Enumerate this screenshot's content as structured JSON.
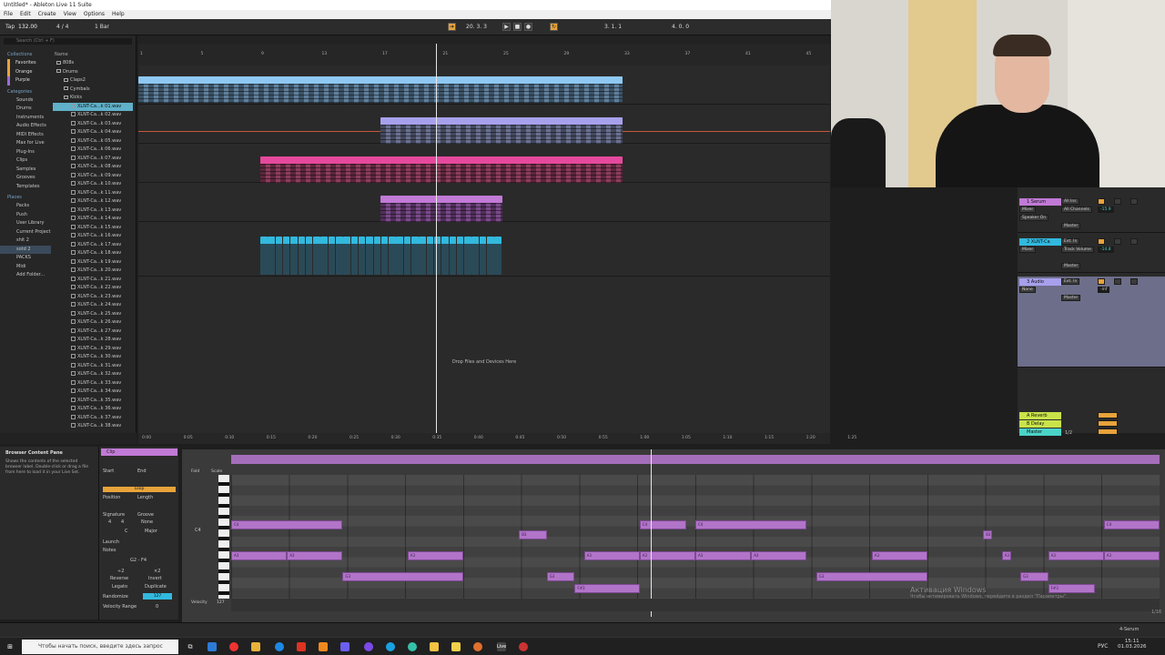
{
  "window": {
    "title": "Untitled* - Ableton Live 11 Suite",
    "menus": [
      "File",
      "Edit",
      "Create",
      "View",
      "Options",
      "Help"
    ]
  },
  "transport": {
    "tap": "Tap",
    "tempo": "132.00",
    "signature": "4 / 4",
    "quantize": "1 Bar",
    "position": "20. 3. 3",
    "loop_start": "3. 1. 1",
    "loop_length": "4. 0. 0",
    "accent": "#e8a33a"
  },
  "browser": {
    "search_placeholder": "Search (Ctrl + F)",
    "collections_header": "Collections",
    "name_header": "Name",
    "collections": [
      "Favorites",
      "Orange",
      "Purple"
    ],
    "categories_header": "Categories",
    "categories": [
      "Sounds",
      "Drums",
      "Instruments",
      "Audio Effects",
      "MIDI Effects",
      "Max for Live",
      "Plug-Ins",
      "Clips",
      "Samples",
      "Grooves",
      "Templates"
    ],
    "places_header": "Places",
    "places": [
      "Packs",
      "Push",
      "User Library",
      "Current Project",
      "shit 2",
      "sotd 2",
      "PACKS",
      "Midi",
      "Add Folder..."
    ],
    "folders": [
      "808s",
      "Drums",
      "Claps2",
      "Cymbals",
      "Kicks"
    ],
    "files": [
      "XLNT-Ca...k 01.wav",
      "XLNT-Ca...k 02.wav",
      "XLNT-Ca...k 03.wav",
      "XLNT-Ca...k 04.wav",
      "XLNT-Ca...k 05.wav",
      "XLNT-Ca...k 06.wav",
      "XLNT-Ca...k 07.wav",
      "XLNT-Ca...k 08.wav",
      "XLNT-Ca...k 09.wav",
      "XLNT-Ca...k 10.wav",
      "XLNT-Ca...k 11.wav",
      "XLNT-Ca...k 12.wav",
      "XLNT-Ca...k 13.wav",
      "XLNT-Ca...k 14.wav",
      "XLNT-Ca...k 15.wav",
      "XLNT-Ca...k 16.wav",
      "XLNT-Ca...k 17.wav",
      "XLNT-Ca...k 18.wav",
      "XLNT-Ca...k 19.wav",
      "XLNT-Ca...k 20.wav",
      "XLNT-Ca...k 21.wav",
      "XLNT-Ca...k 22.wav",
      "XLNT-Ca...k 23.wav",
      "XLNT-Ca...k 24.wav",
      "XLNT-Ca...k 25.wav",
      "XLNT-Ca...k 26.wav",
      "XLNT-Ca...k 27.wav",
      "XLNT-Ca...k 28.wav",
      "XLNT-Ca...k 29.wav",
      "XLNT-Ca...k 30.wav",
      "XLNT-Ca...k 31.wav",
      "XLNT-Ca...k 32.wav",
      "XLNT-Ca...k 33.wav",
      "XLNT-Ca...k 34.wav",
      "XLNT-Ca...k 35.wav",
      "XLNT-Ca...k 36.wav",
      "XLNT-Ca...k 37.wav",
      "XLNT-Ca...k 38.wav"
    ]
  },
  "ruler": {
    "bars": [
      "1",
      "5",
      "9",
      "13",
      "17",
      "21",
      "25",
      "29",
      "33",
      "37",
      "41",
      "45"
    ],
    "times": [
      "0:00",
      "0:05",
      "0:10",
      "0:15",
      "0:20",
      "0:25",
      "0:30",
      "0:35",
      "0:40",
      "0:45",
      "0:50",
      "0:55",
      "1:00",
      "1:05",
      "1:10",
      "1:15",
      "1:20",
      "1:25"
    ]
  },
  "arrangement": {
    "drop_text": "Drop Files and Devices Here"
  },
  "colors": {
    "blue_clip": "#8ec8f2",
    "lavender_clip": "#a7a0ec",
    "pink_clip": "#e5499d",
    "violet_clip": "#c17ad6",
    "cyan_clip": "#32b9de",
    "note": "#b174c9"
  },
  "mixer": {
    "tracks": [
      {
        "name": "1 Serum",
        "input": "All Ins",
        "route": "Mixer",
        "ch": "All Channels",
        "out": "Master",
        "dev": "Speaker On",
        "vol": "-15.9",
        "color": "#c17ad6"
      },
      {
        "name": "2 XLNT-Ca",
        "input": "Ext. In",
        "route": "Mixer",
        "ch": "Track Volume",
        "out": "Master",
        "vol": "-14.8",
        "color": "#32b9de"
      },
      {
        "name": "3 Audio",
        "input": "Ext. In",
        "route": "None",
        "out": "Master",
        "vol": "-inf",
        "color": "#a7a0ec"
      }
    ],
    "returns": [
      {
        "name": "A Reverb",
        "color": "#c9e34a"
      },
      {
        "name": "B Delay",
        "color": "#c9e34a"
      },
      {
        "name": "Master",
        "color": "#4ad3c8"
      }
    ],
    "master_ratio": "1/2"
  },
  "info_view": {
    "title": "Browser Content Pane",
    "text": "Shows the contents of the selected browser label. Double-click or drag a file from here to load it in your Live Set."
  },
  "clip_view": {
    "header": "Clip",
    "start": "Start",
    "end": "End",
    "loop": "Loop",
    "position": "Position",
    "length": "Length",
    "signature": "Signature",
    "groove": "Groove",
    "sig_n": "4",
    "sig_d": "4",
    "groove_val": "None",
    "scale_root": "C",
    "scale_mode": "Major",
    "launch": "Launch",
    "notes": "Notes",
    "range": "G2 - F4",
    "x2": "÷2",
    "times2": "×2",
    "reverse": "Reverse",
    "invert": "Invert",
    "legato": "Legato",
    "duplicate": "Duplicate",
    "randomize": "Randomize",
    "rand_val": "127",
    "vel_range": "Velocity Range",
    "vel_val": "0"
  },
  "piano_roll": {
    "fold": "Fold",
    "scale": "Scale",
    "c4": "C4",
    "velocity": "Velocity",
    "vel_max": "127",
    "ratio": "1/16",
    "notes": [
      {
        "lbl": "C4",
        "row": 0,
        "s": 0.0,
        "e": 0.12
      },
      {
        "lbl": "C4",
        "row": 0,
        "s": 0.44,
        "e": 0.49
      },
      {
        "lbl": "C4",
        "row": 0,
        "s": 0.5,
        "e": 0.62
      },
      {
        "lbl": "C4",
        "row": 0,
        "s": 0.94,
        "e": 1.0
      },
      {
        "lbl": "B3",
        "row": 1,
        "s": 0.31,
        "e": 0.34
      },
      {
        "lbl": "B3",
        "row": 1,
        "s": 0.81,
        "e": 0.82
      },
      {
        "lbl": "A3",
        "row": 3,
        "s": 0.0,
        "e": 0.06
      },
      {
        "lbl": "A3",
        "row": 3,
        "s": 0.06,
        "e": 0.12
      },
      {
        "lbl": "A3",
        "row": 3,
        "s": 0.19,
        "e": 0.25
      },
      {
        "lbl": "A3",
        "row": 3,
        "s": 0.38,
        "e": 0.44
      },
      {
        "lbl": "A3",
        "row": 3,
        "s": 0.44,
        "e": 0.5
      },
      {
        "lbl": "A3",
        "row": 3,
        "s": 0.5,
        "e": 0.56
      },
      {
        "lbl": "A3",
        "row": 3,
        "s": 0.56,
        "e": 0.62
      },
      {
        "lbl": "A3",
        "row": 3,
        "s": 0.69,
        "e": 0.75
      },
      {
        "lbl": "A3",
        "row": 3,
        "s": 0.83,
        "e": 0.84
      },
      {
        "lbl": "A3",
        "row": 3,
        "s": 0.88,
        "e": 0.94
      },
      {
        "lbl": "A3",
        "row": 3,
        "s": 0.94,
        "e": 1.0
      },
      {
        "lbl": "G3",
        "row": 5,
        "s": 0.12,
        "e": 0.25
      },
      {
        "lbl": "G3",
        "row": 5,
        "s": 0.34,
        "e": 0.37
      },
      {
        "lbl": "G3",
        "row": 5,
        "s": 0.63,
        "e": 0.75
      },
      {
        "lbl": "G3",
        "row": 5,
        "s": 0.85,
        "e": 0.88
      },
      {
        "lbl": "F#3",
        "row": 6,
        "s": 0.37,
        "e": 0.44
      },
      {
        "lbl": "F#3",
        "row": 6,
        "s": 0.88,
        "e": 0.93
      }
    ]
  },
  "windows_activation": {
    "title": "Активация Windows",
    "text": "Чтобы активировать Windows, перейдите в раздел \"Параметры\"."
  },
  "status": {
    "track": "4-Serum"
  },
  "taskbar": {
    "search_placeholder": "Чтобы начать поиск, введите здесь запрос",
    "lang": "РУС",
    "time": "15:11",
    "date": "01.03.2026"
  }
}
